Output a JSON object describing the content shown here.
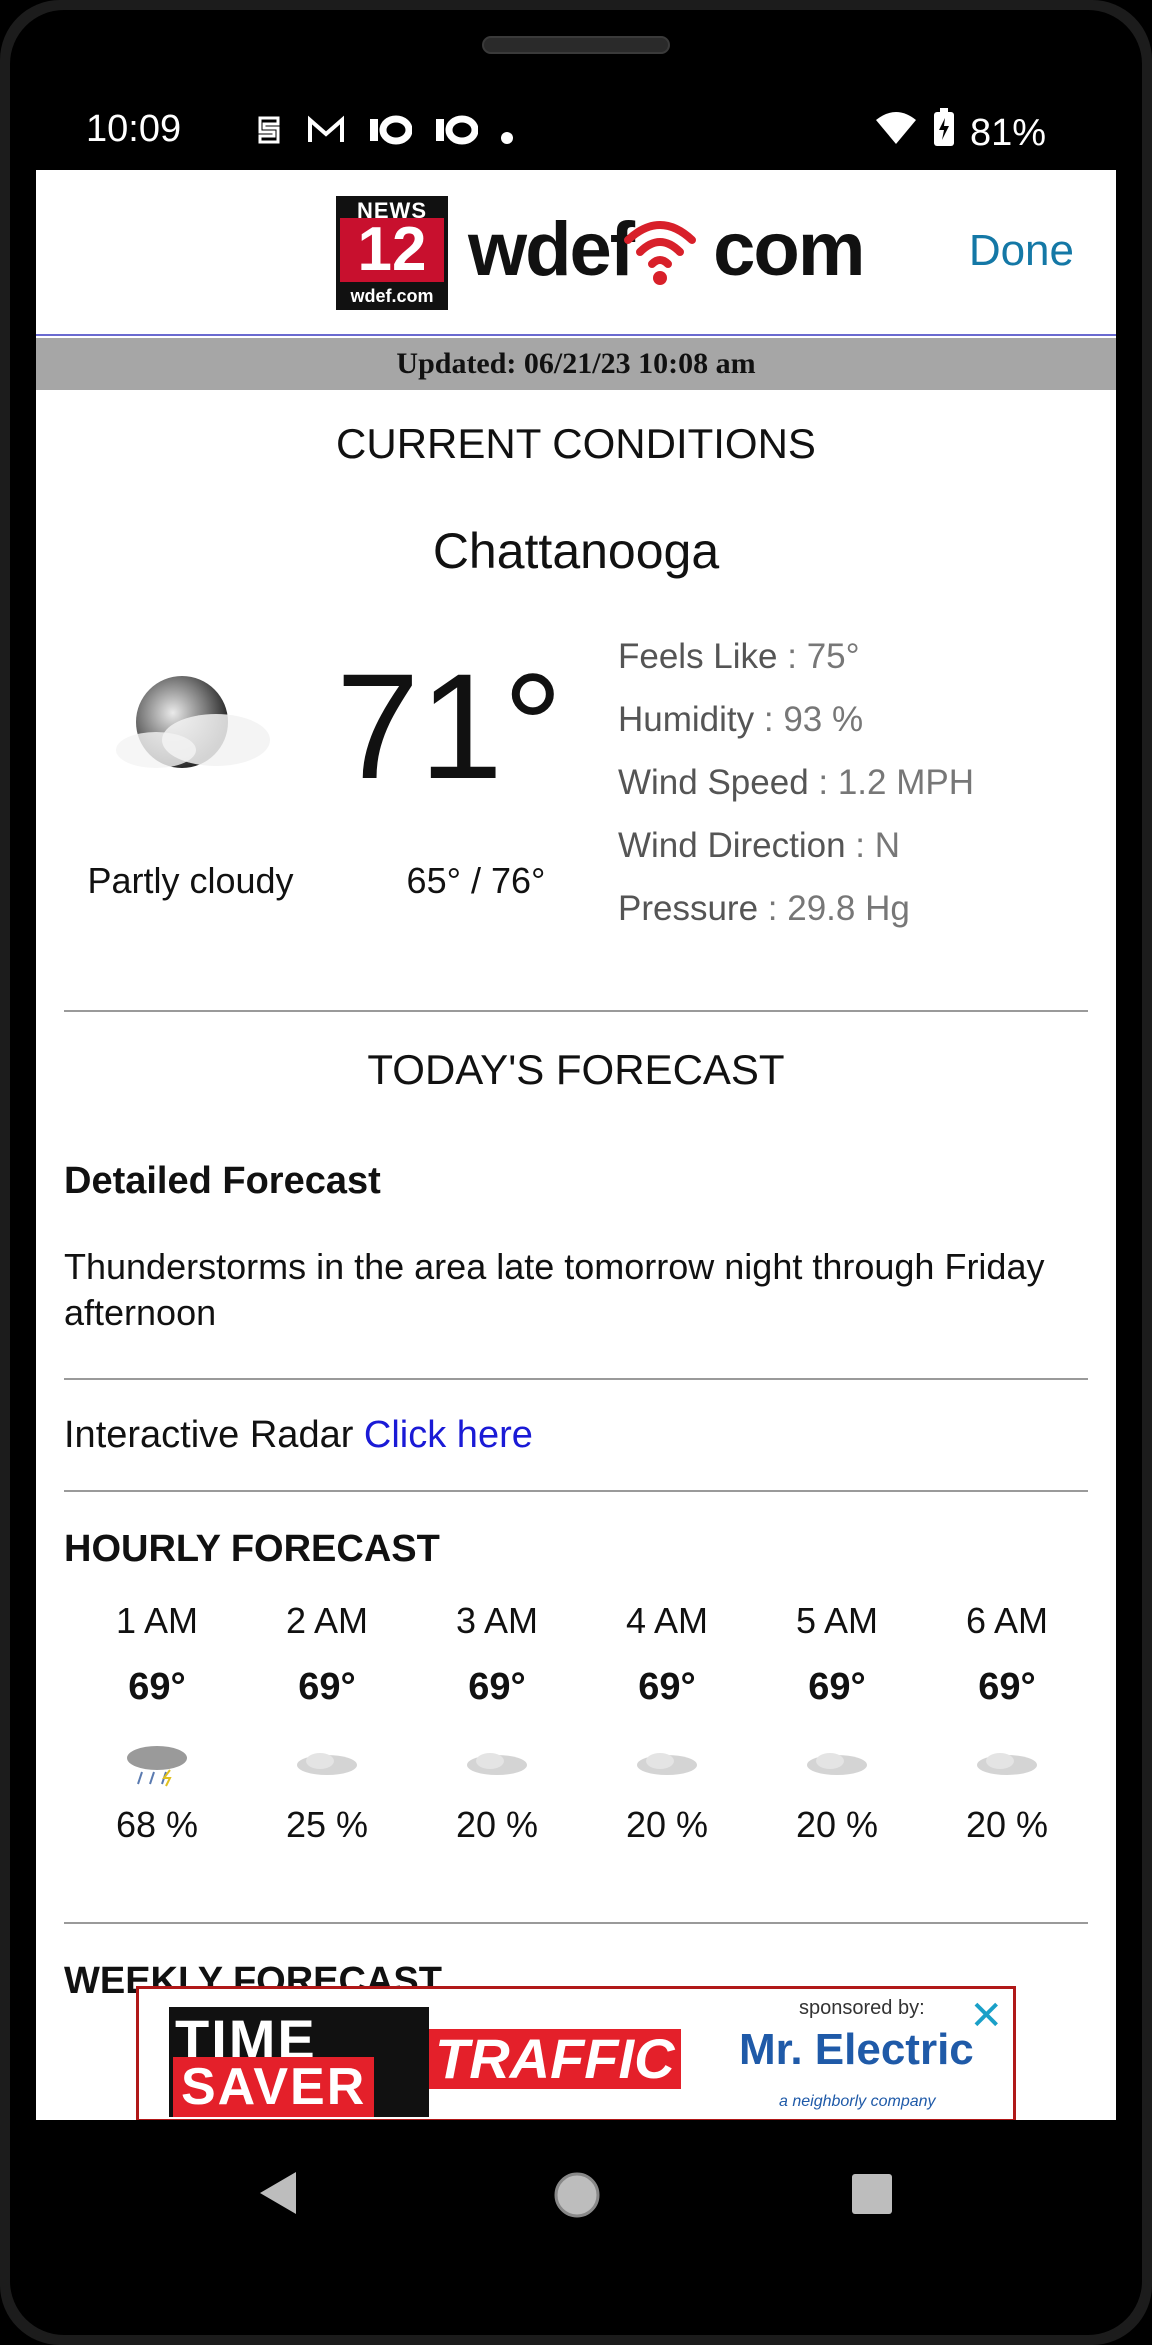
{
  "status_bar": {
    "time": "10:09",
    "battery": "81%",
    "left_icons": [
      "sim-s-icon",
      "gmail-icon",
      "news10-icon",
      "news10-icon",
      "dot-icon"
    ]
  },
  "header": {
    "logo_news": "NEWS",
    "logo_number": "12",
    "logo_small": "wdef.com",
    "logo_text_left": "wdef",
    "logo_text_right": "com",
    "done_label": "Done"
  },
  "updated": "Updated: 06/21/23 10:08 am",
  "current": {
    "section_title": "CURRENT CONDITIONS",
    "city": "Chattanooga",
    "temp": "71°",
    "condition": "Partly cloudy",
    "range": "65° / 76°",
    "details": [
      {
        "label": "Feels Like",
        "value": " : 75°"
      },
      {
        "label": "Humidity",
        "value": " : 93 %"
      },
      {
        "label": "Wind Speed",
        "value": " : 1.2 MPH"
      },
      {
        "label": "Wind Direction",
        "value": " : N"
      },
      {
        "label": "Pressure",
        "value": " : 29.8 Hg"
      }
    ]
  },
  "today": {
    "section_title": "TODAY'S FORECAST",
    "detailed_heading": "Detailed Forecast",
    "detailed_text": "Thunderstorms in the area late tomorrow night through Friday afternoon",
    "radar_label": "Interactive Radar ",
    "radar_link": "Click here"
  },
  "hourly": {
    "heading": "HOURLY FORECAST",
    "hours": [
      {
        "time": "1 AM",
        "temp": "69°",
        "pct": "68 %",
        "icon": "storm-cloud-icon"
      },
      {
        "time": "2 AM",
        "temp": "69°",
        "pct": "25 %",
        "icon": "cloud-icon"
      },
      {
        "time": "3 AM",
        "temp": "69°",
        "pct": "20 %",
        "icon": "cloud-icon"
      },
      {
        "time": "4 AM",
        "temp": "69°",
        "pct": "20 %",
        "icon": "cloud-icon"
      },
      {
        "time": "5 AM",
        "temp": "69°",
        "pct": "20 %",
        "icon": "cloud-icon"
      },
      {
        "time": "6 AM",
        "temp": "69°",
        "pct": "20 %",
        "icon": "cloud-icon"
      }
    ]
  },
  "weekly": {
    "heading": "WEEKLY FORECAST"
  },
  "ad": {
    "time": "TIME",
    "saver": "SAVER",
    "traffic": "TRAFFIC",
    "sponsored": "sponsored by:",
    "brand": "Mr. Electric",
    "sub": "a neighborly company",
    "close": "✕"
  },
  "colors": {
    "accent_link": "#1a1ad6",
    "done": "#1478a6",
    "updated_bar": "#a6a6a6",
    "brand_red": "#c8102e"
  }
}
